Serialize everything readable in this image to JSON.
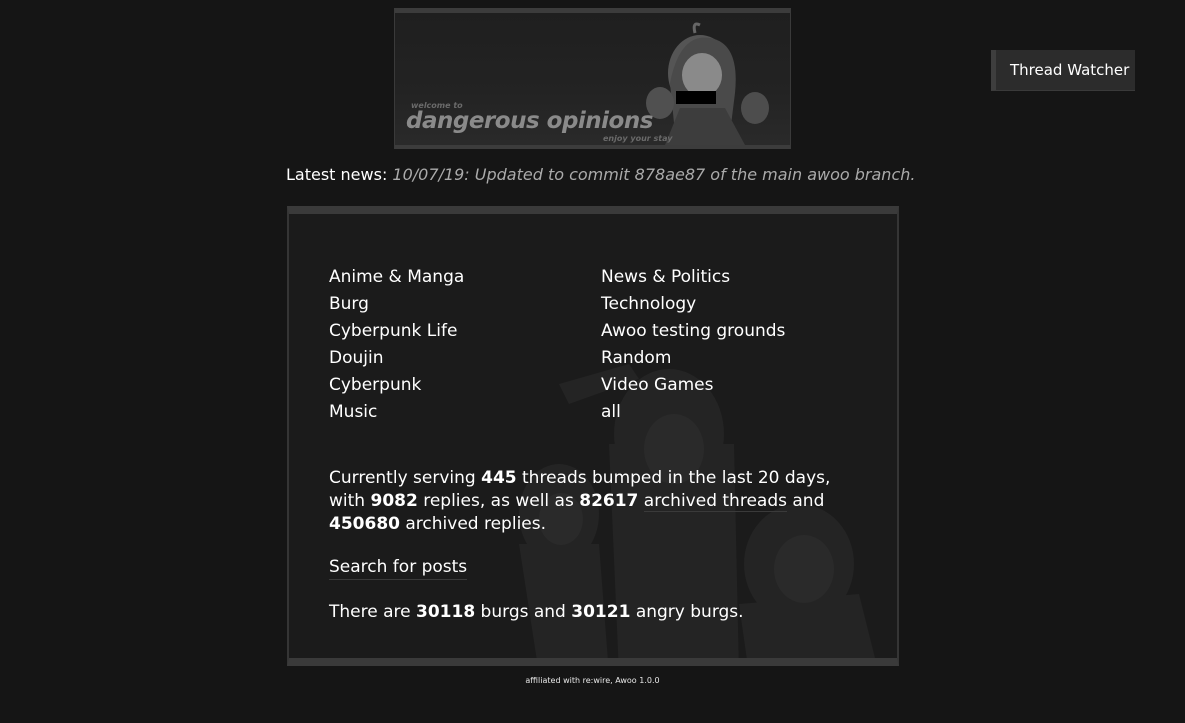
{
  "banner": {
    "welcome": "welcome to",
    "title": "dangerous opinions",
    "subtitle": "enjoy your stay"
  },
  "thread_watcher": {
    "label": "Thread Watcher"
  },
  "news": {
    "label": "Latest news:",
    "text": "10/07/19: Updated to commit 878ae87 of the main awoo branch."
  },
  "boards": {
    "left": [
      "Anime & Manga",
      "Burg",
      "Cyberpunk Life",
      "Doujin",
      "Cyberpunk",
      "Music"
    ],
    "right": [
      "News & Politics",
      "Technology",
      "Awoo testing grounds",
      "Random",
      "Video Games",
      "all"
    ]
  },
  "stats": {
    "t1": "Currently serving ",
    "threads": "445",
    "t2": " threads bumped in the last 20 days, with ",
    "replies": "9082",
    "t3": " replies, as well as ",
    "archived_threads": "82617",
    "archived_threads_label": "archived threads",
    "t4": " and ",
    "archived_replies": "450680",
    "t5": " archived replies."
  },
  "search": {
    "label": "Search for posts"
  },
  "burgs": {
    "t1": "There are ",
    "count": "30118",
    "t2": " burgs and ",
    "angry": "30121",
    "t3": " angry burgs."
  },
  "footer": {
    "text": "affiliated with re:wire, Awoo 1.0.0"
  },
  "colors": {
    "background": "#151515",
    "panel": "#1b1b1b",
    "panel_border": "#3a3a3a",
    "news_text": "#aaaaaa",
    "text": "#ffffff"
  }
}
